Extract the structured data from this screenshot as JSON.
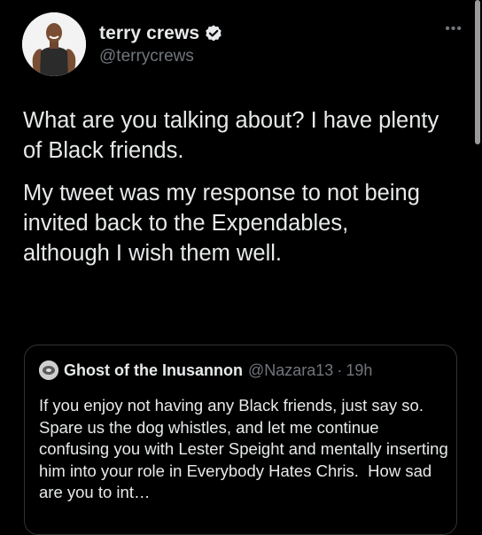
{
  "author": {
    "display_name": "terry crews",
    "handle": "@terrycrews",
    "verified": true,
    "avatar_icon": "profile-photo"
  },
  "more_icon": "ellipsis-icon",
  "more_label": "•••",
  "tweet": {
    "paragraphs": [
      "What are you talking about? I have plenty of Black friends.",
      "My tweet was my response to not being invited back to the Expendables, although I wish them well."
    ]
  },
  "quoted_tweet": {
    "display_name": "Ghost of the Inusannon",
    "handle": "@Nazara13",
    "separator": "·",
    "time": "19h",
    "text": "If you enjoy not having any Black friends, just say so.  Spare us the dog whistles, and let me continue confusing you with Lester Speight and mentally inserting him into your role in Everybody Hates Chris.  How sad are you to int…"
  },
  "colors": {
    "background": "#000000",
    "primary_text": "#e7e9ea",
    "secondary_text": "#71767b",
    "verified_badge": "#e7e9ea",
    "border": "#2f3336"
  }
}
